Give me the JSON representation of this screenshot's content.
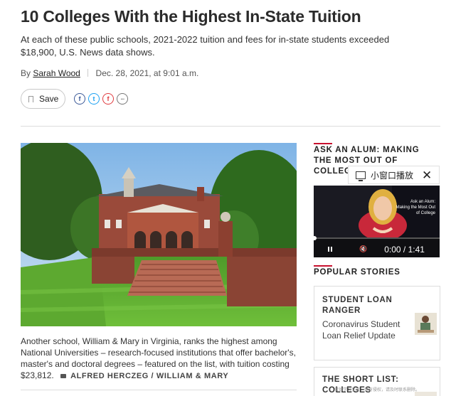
{
  "article": {
    "title": "10 Colleges With the Highest In-State Tuition",
    "dek": "At each of these public schools, 2021-2022 tuition and fees for in-state students exceeded $18,900, U.S. News data shows.",
    "byline_prefix": "By",
    "author": "Sarah Wood",
    "date": "Dec. 28, 2021, at 9:01 a.m.",
    "save_label": "Save",
    "share_icons": [
      "facebook-icon",
      "twitter-icon",
      "flipboard-icon",
      "more-share-icon"
    ],
    "image_caption": "Another school, William & Mary in Virginia, ranks the highest among National Universities – research-focused institutions that offer bachelor's, master's and doctoral degrees – featured on the list, with tuition costing $23,812.",
    "image_credit": "ALFRED HERCZEG / WILLIAM & MARY"
  },
  "sidebar": {
    "ask_alum_heading": "ASK AN ALUM: MAKING THE MOST OUT OF COLLEGE",
    "mini_window": {
      "label": "小窗口播放",
      "icon": "monitor-icon",
      "close_icon": "close-icon"
    },
    "video": {
      "overlay_title": "Ask an Alum: Making the Most Out of College",
      "current_time": "0:00",
      "separator": "/",
      "duration": "1:41",
      "progress": 0
    },
    "popular_heading": "POPULAR STORIES",
    "stories": [
      {
        "title": "STUDENT LOAN RANGER",
        "summary": "Coronavirus Student Loan Relief Update"
      },
      {
        "title": "THE SHORT LIST: COLLEGES",
        "summary": ""
      }
    ],
    "watermark": "仅供学习交流，如有侵权，请及时联系删除。"
  },
  "colors": {
    "accent_red": "#c8102e",
    "facebook": "#3b5998",
    "twitter": "#1da1f2"
  }
}
